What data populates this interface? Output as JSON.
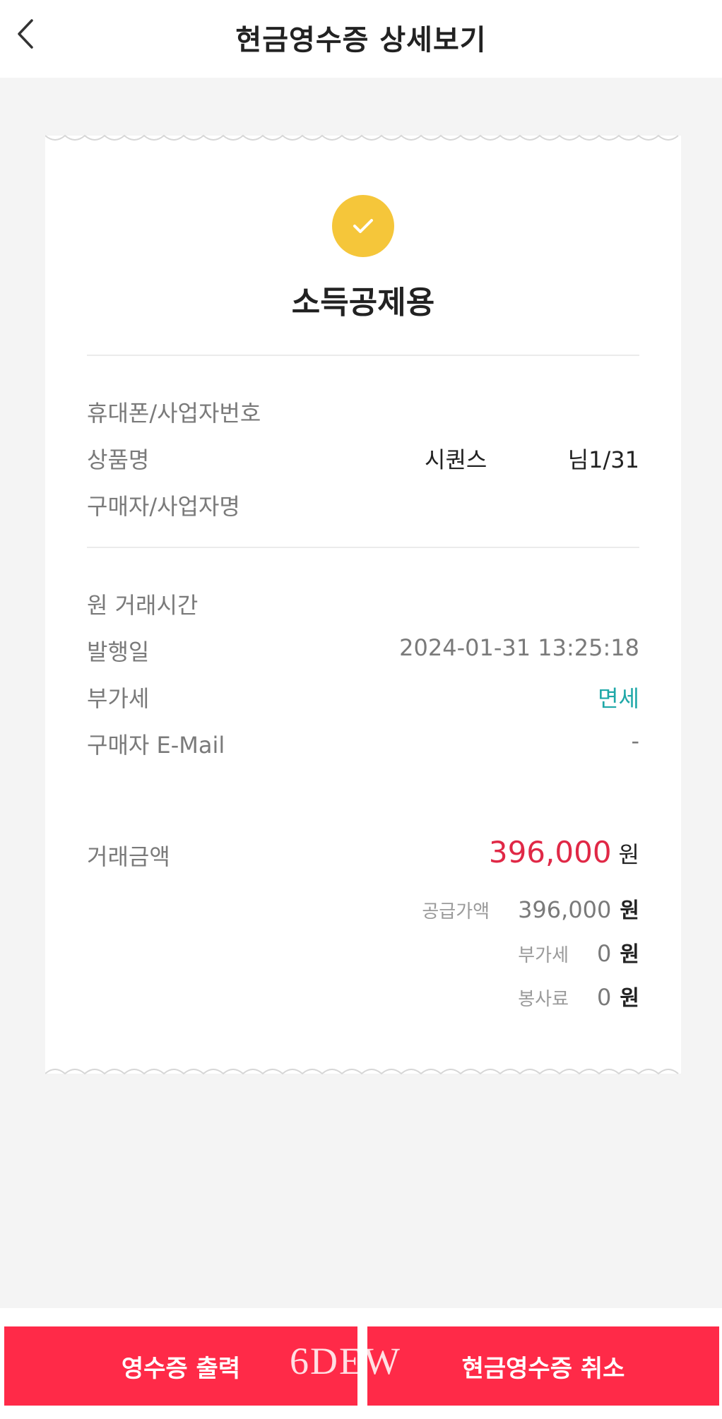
{
  "header": {
    "title": "현금영수증 상세보기",
    "back_icon": "chevron-left-icon"
  },
  "receipt": {
    "status_icon": "check-icon",
    "status_color": "#f5c63a",
    "type": "소득공제용",
    "fields": {
      "phone_business_label": "휴대폰/사업자번호",
      "product_label": "상품명",
      "product_name": "시퀀스",
      "product_suffix": "님1/31",
      "buyer_label": "구매자/사업자명",
      "original_time_label": "원 거래시간",
      "issue_date_label": "발행일",
      "issue_date_value": "2024-01-31 13:25:18",
      "vat_label": "부가세",
      "vat_value": "면세",
      "email_label": "구매자 E-Mail",
      "email_value": "-"
    },
    "amount": {
      "label": "거래금액",
      "value": "396,000",
      "unit": "원",
      "supply_label": "공급가액",
      "supply_value": "396,000",
      "supply_unit": "원",
      "vat_label": "부가세",
      "vat_value": "0",
      "vat_unit": "원",
      "service_label": "봉사료",
      "service_value": "0",
      "service_unit": "원"
    }
  },
  "buttons": {
    "print": "영수증 출력",
    "cancel": "현금영수증 취소"
  },
  "watermark": "6DEW",
  "colors": {
    "accent_red": "#ff2a48",
    "amount_red": "#e02846",
    "teal": "#1fa8a8"
  }
}
